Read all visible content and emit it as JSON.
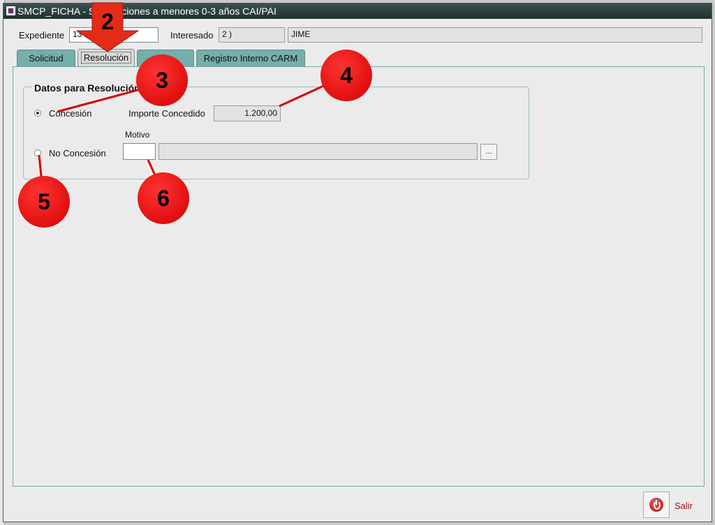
{
  "window": {
    "title": "SMCP_FICHA - Subvenciones a menores 0-3 años CAI/PAI"
  },
  "header": {
    "expediente_label": "Expediente",
    "expediente_value": "13                 2023",
    "interesado_label": "Interesado",
    "interesado_code": "2                  )",
    "interesado_name": "JIME"
  },
  "tabs": [
    {
      "label": "Solicitud",
      "active": false
    },
    {
      "label": "Resolución",
      "active": true
    },
    {
      "label": "",
      "active": false
    },
    {
      "label": "Registro Interno CARM",
      "active": false
    }
  ],
  "resolucion": {
    "group_title": "Datos para Resolución",
    "concesion_label": "Concesión",
    "concesion_selected": true,
    "importe_label": "Importe Concedido",
    "importe_value": "1.200,00",
    "motivo_label": "Motivo",
    "no_concesion_label": "No Concesión",
    "no_concesion_selected": false,
    "motivo_code": "",
    "motivo_desc": "",
    "lov_button_label": "..."
  },
  "footer": {
    "salir_label": "Salir"
  },
  "callouts": [
    "2",
    "3",
    "4",
    "5",
    "6"
  ],
  "colors": {
    "accent_tab": "#75aeab",
    "callout": "#e00000",
    "title_bar": "#2b3d3d"
  },
  "icons": {
    "app": "app-icon",
    "salir": "power-icon"
  }
}
